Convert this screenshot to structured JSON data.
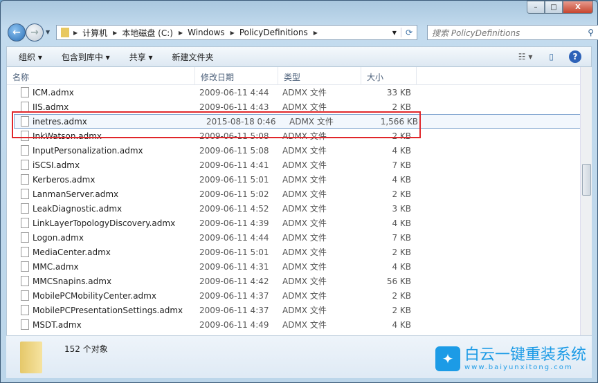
{
  "window": {
    "min": "–",
    "max": "□",
    "close": "X"
  },
  "address": {
    "segments": [
      "计算机",
      "本地磁盘 (C:)",
      "Windows",
      "PolicyDefinitions"
    ]
  },
  "search": {
    "placeholder": "搜索 PolicyDefinitions"
  },
  "toolbar": {
    "organize": "组织 ▾",
    "include": "包含到库中 ▾",
    "share": "共享 ▾",
    "new_folder": "新建文件夹"
  },
  "columns": {
    "name": "名称",
    "date": "修改日期",
    "type": "类型",
    "size": "大小"
  },
  "files": [
    {
      "name": "ICM.admx",
      "date": "2009-06-11 4:44",
      "type": "ADMX 文件",
      "size": "33 KB"
    },
    {
      "name": "IIS.admx",
      "date": "2009-06-11 4:43",
      "type": "ADMX 文件",
      "size": "2 KB"
    },
    {
      "name": "inetres.admx",
      "date": "2015-08-18 0:46",
      "type": "ADMX 文件",
      "size": "1,566 KB"
    },
    {
      "name": "InkWatson.admx",
      "date": "2009-06-11 5:08",
      "type": "ADMX 文件",
      "size": "2 KB"
    },
    {
      "name": "InputPersonalization.admx",
      "date": "2009-06-11 5:08",
      "type": "ADMX 文件",
      "size": "4 KB"
    },
    {
      "name": "iSCSI.admx",
      "date": "2009-06-11 4:41",
      "type": "ADMX 文件",
      "size": "7 KB"
    },
    {
      "name": "Kerberos.admx",
      "date": "2009-06-11 5:01",
      "type": "ADMX 文件",
      "size": "4 KB"
    },
    {
      "name": "LanmanServer.admx",
      "date": "2009-06-11 5:02",
      "type": "ADMX 文件",
      "size": "2 KB"
    },
    {
      "name": "LeakDiagnostic.admx",
      "date": "2009-06-11 4:52",
      "type": "ADMX 文件",
      "size": "3 KB"
    },
    {
      "name": "LinkLayerTopologyDiscovery.admx",
      "date": "2009-06-11 4:39",
      "type": "ADMX 文件",
      "size": "4 KB"
    },
    {
      "name": "Logon.admx",
      "date": "2009-06-11 4:44",
      "type": "ADMX 文件",
      "size": "7 KB"
    },
    {
      "name": "MediaCenter.admx",
      "date": "2009-06-11 5:01",
      "type": "ADMX 文件",
      "size": "2 KB"
    },
    {
      "name": "MMC.admx",
      "date": "2009-06-11 4:31",
      "type": "ADMX 文件",
      "size": "4 KB"
    },
    {
      "name": "MMCSnapins.admx",
      "date": "2009-06-11 4:42",
      "type": "ADMX 文件",
      "size": "56 KB"
    },
    {
      "name": "MobilePCMobilityCenter.admx",
      "date": "2009-06-11 4:37",
      "type": "ADMX 文件",
      "size": "2 KB"
    },
    {
      "name": "MobilePCPresentationSettings.admx",
      "date": "2009-06-11 4:37",
      "type": "ADMX 文件",
      "size": "2 KB"
    },
    {
      "name": "MSDT.admx",
      "date": "2009-06-11 4:49",
      "type": "ADMX 文件",
      "size": "4 KB"
    }
  ],
  "status": {
    "count": "152 个对象"
  },
  "watermark": {
    "title": "白云一键重装系统",
    "url": "www.baiyunxitong.com"
  }
}
